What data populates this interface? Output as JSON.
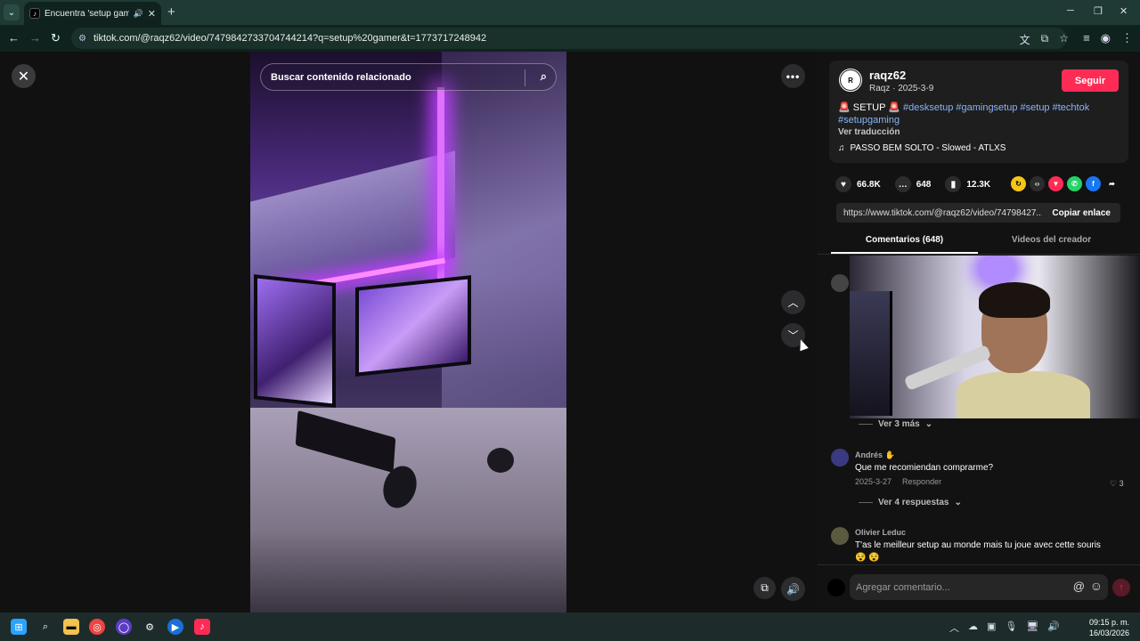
{
  "browser": {
    "tab_title": "Encuentra 'setup gamer' en",
    "tab_close": "✕",
    "new_tab": "+",
    "url": "tiktok.com/@raqz62/video/7479842733704744214?q=setup%20gamer&t=1773717248942",
    "window_controls": [
      "─",
      "❐",
      "✕"
    ]
  },
  "player": {
    "search_placeholder": "Buscar contenido relacionado",
    "close": "✕",
    "more": "•••",
    "up": "︿",
    "down": "﹀"
  },
  "creator": {
    "username": "raqz62",
    "subline": "Raqz · 2025-3-9",
    "follow_label": "Seguir",
    "caption_prefix": "🚨 SETUP 🚨",
    "hashtags": "#desksetup #gamingsetup #setup #techtok",
    "hashtags2": "#setupgaming",
    "translate": "Ver traducción",
    "music": "PASSO BEM SOLTO - Slowed - ATLXS"
  },
  "stats": {
    "likes": "66.8K",
    "comments": "648",
    "saves": "12.3K"
  },
  "share": {
    "link": "https://www.tiktok.com/@raqz62/video/74798427...",
    "copy_label": "Copiar enlace"
  },
  "tabs": {
    "comments": "Comentarios (648)",
    "creator_videos": "Videos del creador"
  },
  "comments": {
    "more_1": "Ver 3 más",
    "c1_name": "Andrés ✋",
    "c1_text": "Que me recomiendan comprarme?",
    "c1_date": "2025-3-27",
    "c1_reply": "Responder",
    "c1_likes": "3",
    "c1_more": "Ver 4 respuestas",
    "c2_name": "Olivier Leduc",
    "c2_text": "T'as le meilleur setup au monde mais tu joue avec cette souris😵 😵"
  },
  "composer": {
    "placeholder": "Agregar comentario..."
  },
  "taskbar": {
    "time": "09:15 p. m.",
    "date": "16/03/2026"
  }
}
